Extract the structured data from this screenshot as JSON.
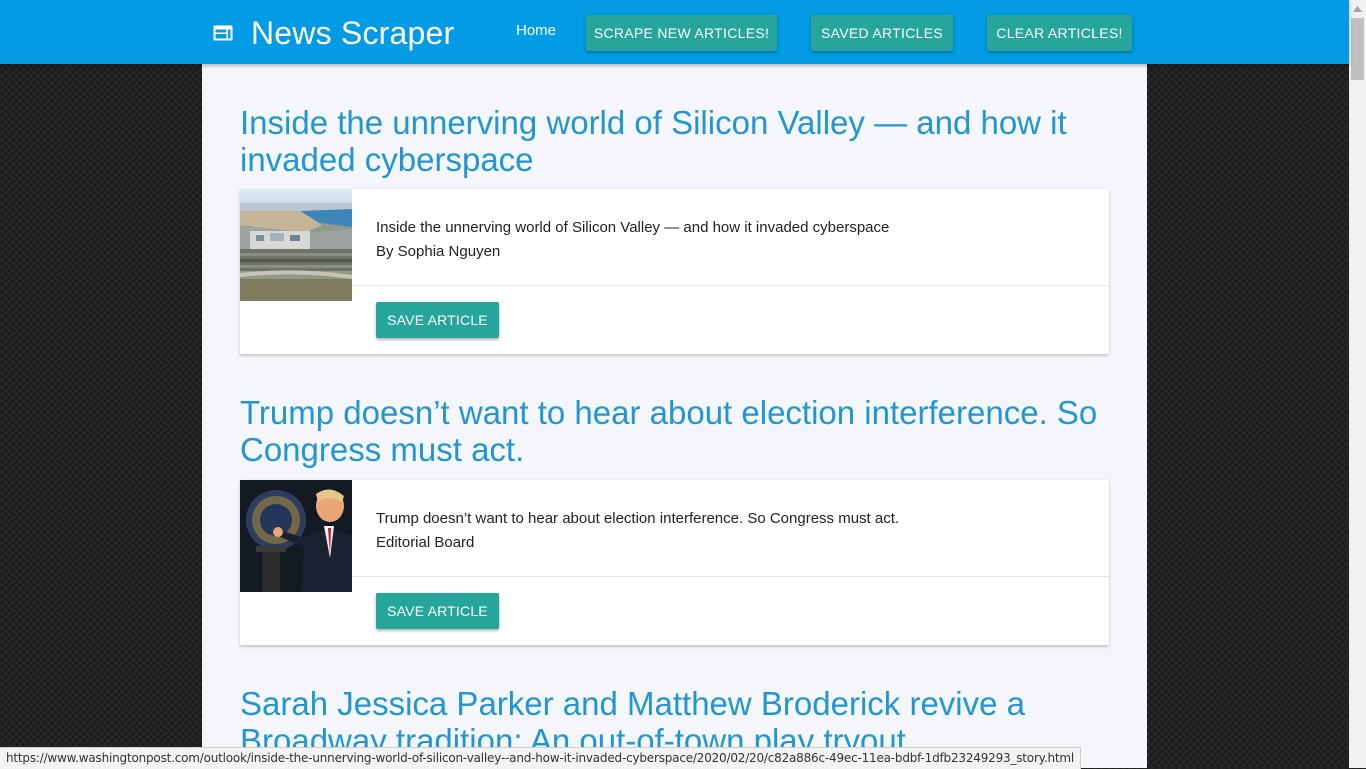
{
  "navbar": {
    "brand_icon": "web-icon",
    "brand_text": "News Scraper",
    "home_label": "Home",
    "scrape_label": "SCRAPE NEW ARTICLES!",
    "saved_label": "SAVED ARTICLES",
    "clear_label": "CLEAR ARTICLES!"
  },
  "articles": [
    {
      "title": "Inside the unnerving world of Silicon Valley — and how it invaded cyberspace",
      "summary": "Inside the unnerving world of Silicon Valley — and how it invaded cyberspace",
      "byline": "By Sophia Nguyen",
      "save_label": "SAVE ARTICLE",
      "image": "aerial-campus-photo"
    },
    {
      "title": "Trump doesn’t want to hear about election interference. So Congress must act.",
      "summary": "Trump doesn’t want to hear about election interference. So Congress must act.",
      "byline": "Editorial Board",
      "save_label": "SAVE ARTICLE",
      "image": "podium-speaker-photo"
    },
    {
      "title": "Sarah Jessica Parker and Matthew Broderick revive a Broadway tradition: An out-of-town play tryout"
    }
  ],
  "status_bar": {
    "url": "https://www.washingtonpost.com/outlook/inside-the-unnerving-world-of-silicon-valley--and-how-it-invaded-cyberspace/2020/02/20/c82a886c-49ec-11ea-bdbf-1dfb23249293_story.html"
  },
  "colors": {
    "navbar": "#039be5",
    "button": "#26a69a",
    "title": "#2196d3",
    "container": "#f5f6fb"
  }
}
